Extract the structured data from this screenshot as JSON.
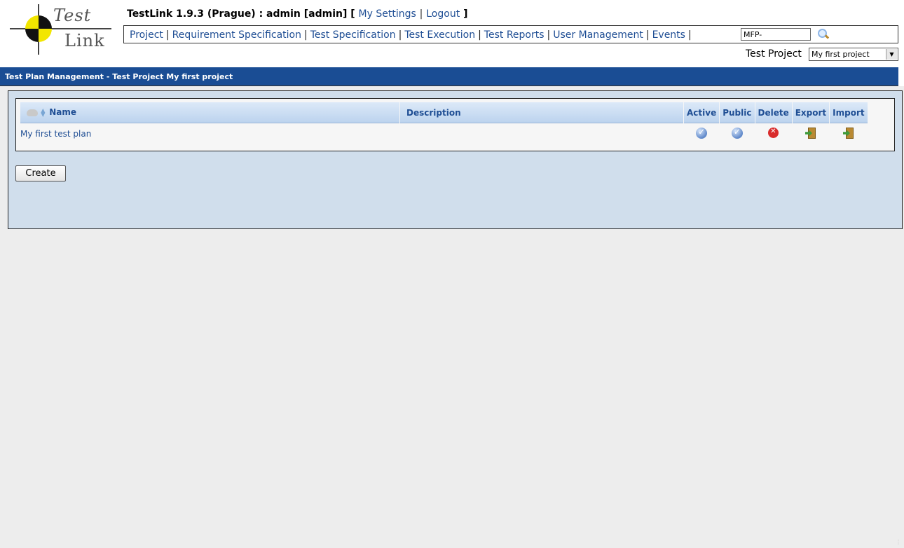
{
  "logo": {
    "word1": "Test",
    "word2": "Link"
  },
  "title": {
    "app": "TestLink 1.9.3 (Prague) : admin [admin] [",
    "my_settings": "My Settings",
    "pipe": "|",
    "logout": "Logout",
    "close": "]"
  },
  "menu": {
    "items": [
      "Project",
      "Requirement Specification",
      "Test Specification",
      "Test Execution",
      "Test Reports",
      "User Management",
      "Events"
    ],
    "search_value": "MFP-",
    "search_icon": "magnifier-icon"
  },
  "project": {
    "label": "Test Project",
    "selected": "My first project"
  },
  "section_title": "Test Plan Management - Test Project My first project",
  "table": {
    "columns": [
      "Name",
      "Description",
      "Active",
      "Public",
      "Delete",
      "Export",
      "Import"
    ],
    "rows": [
      {
        "name": "My first test plan",
        "description": "",
        "active": true,
        "public": true
      }
    ]
  },
  "create_label": "Create",
  "icons": {
    "active": "checkmark-icon",
    "public": "checkmark-icon",
    "delete": "delete-icon",
    "export": "export-door-icon",
    "import": "import-door-icon"
  },
  "colors": {
    "header_bar": "#1a4d94",
    "panel": "#d0deec",
    "link": "#1f4e94",
    "page_bg": "#ededed"
  }
}
